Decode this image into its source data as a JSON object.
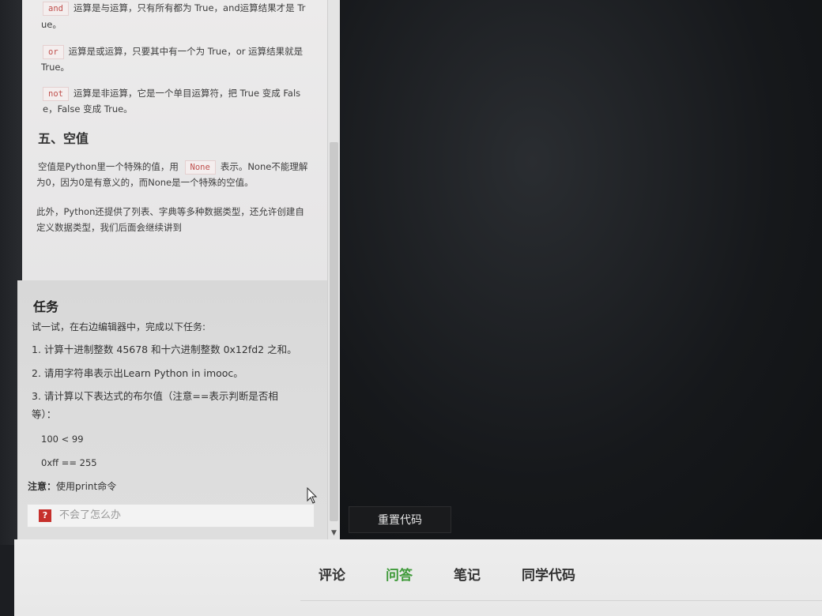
{
  "lesson": {
    "and_code": "and",
    "and_text_1": "运算是与运算，只有所有都为 True，and运算结果才是 Tr",
    "and_text_2": "ue。",
    "or_code": "or",
    "or_text_1": "运算是或运算，只要其中有一个为 True，or 运算结果就是",
    "or_text_2": "True。",
    "not_code": "not",
    "not_text_1": "运算是非运算，它是一个单目运算符，把 True 变成 Fals",
    "not_text_2": "e，False 变成 True。",
    "section_heading": "五、空值",
    "none_text_a": "空值是Python里一个特殊的值，用",
    "none_code": "None",
    "none_text_b": "表示。None不能理解",
    "none_text_2": "为0，因为0是有意义的，而None是一个特殊的空值。",
    "extra_1": "此外，Python还提供了列表、字典等多种数据类型，还允许创建自",
    "extra_2": "定义数据类型，我们后面会继续讲到"
  },
  "task": {
    "title": "任务",
    "intro": "试一试，在右边编辑器中，完成以下任务:",
    "item1": "1. 计算十进制整数 45678 和十六进制整数 0x12fd2 之和。",
    "item2": "2. 请用字符串表示出Learn Python in imooc。",
    "item3_1": "3. 请计算以下表达式的布尔值（注意==表示判断是否相",
    "item3_2": "等）：",
    "expr1": "100 < 99",
    "expr2": "0xff == 255",
    "note_label": "注意：",
    "note_text": "使用print命令",
    "help_icon": "?",
    "help_text": "不会了怎么办"
  },
  "editor": {
    "reset_label": "重置代码"
  },
  "tabs": [
    {
      "label": "评论"
    },
    {
      "label": "问答"
    },
    {
      "label": "笔记"
    },
    {
      "label": "同学代码"
    }
  ],
  "colors": {
    "active_tab": "#3f9a3a",
    "code_text": "#c0504d",
    "help_icon_bg": "#c6302c"
  },
  "icons": {
    "cursor": "mouse-pointer-icon",
    "help": "question-mark-icon",
    "scroll_down": "scroll-down-arrow-icon"
  }
}
